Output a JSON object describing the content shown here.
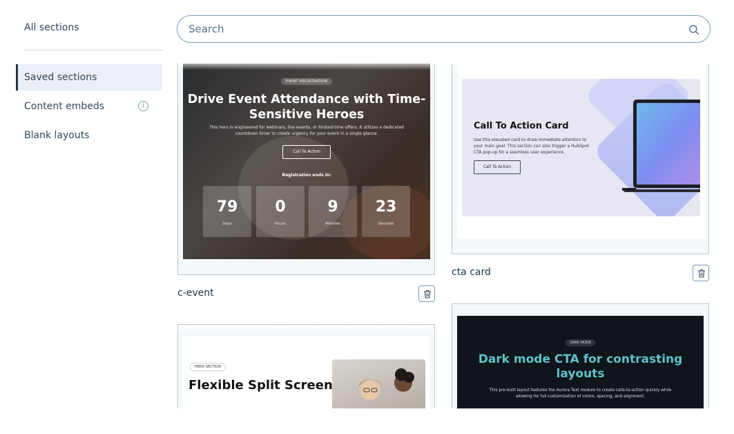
{
  "sidebar": {
    "all_sections": "All sections",
    "items": [
      {
        "label": "Saved sections",
        "active": true
      },
      {
        "label": "Content embeds",
        "info_icon": "info-icon"
      },
      {
        "label": "Blank layouts"
      }
    ]
  },
  "search": {
    "placeholder": "Search",
    "icon": "search-icon"
  },
  "cards": {
    "event": {
      "name": "c-event",
      "preview": {
        "badge": "EVENT REGISTRATION",
        "title": "Drive Event Attendance with Time-Sensitive Heroes",
        "description": "This hero is engineered for webinars, live events, or limited-time offers. It utilizes a dedicated countdown timer to create urgency for your event in a single glance.",
        "button": "Call To Action",
        "countdown_label": "Registration ends in:",
        "countdown": [
          {
            "value": "79",
            "unit": "Days"
          },
          {
            "value": "0",
            "unit": "Hours"
          },
          {
            "value": "9",
            "unit": "Minutes"
          },
          {
            "value": "23",
            "unit": "Seconds"
          }
        ]
      }
    },
    "cta": {
      "name": "cta card",
      "preview": {
        "title": "Call To Action Card",
        "description": "Use this elevated card to draw immediate attention to your main goal. This section can also trigger a HubSpot CTA pop-up for a seamless user experience.",
        "button": "Call To Action"
      }
    },
    "hero": {
      "preview": {
        "badge": "HERO SECTION",
        "title": "Flexible Split Screen Hero"
      }
    },
    "dark": {
      "preview": {
        "badge": "DARK MODE",
        "title": "Dark mode CTA for contrasting layouts",
        "description": "This pre-built layout features the Aurora Text module to create calls-to-action quickly while allowing for full customization of colors, spacing, and alignment."
      }
    }
  },
  "icons": {
    "delete": "trash-icon",
    "info": "info-icon",
    "search": "search-icon"
  }
}
